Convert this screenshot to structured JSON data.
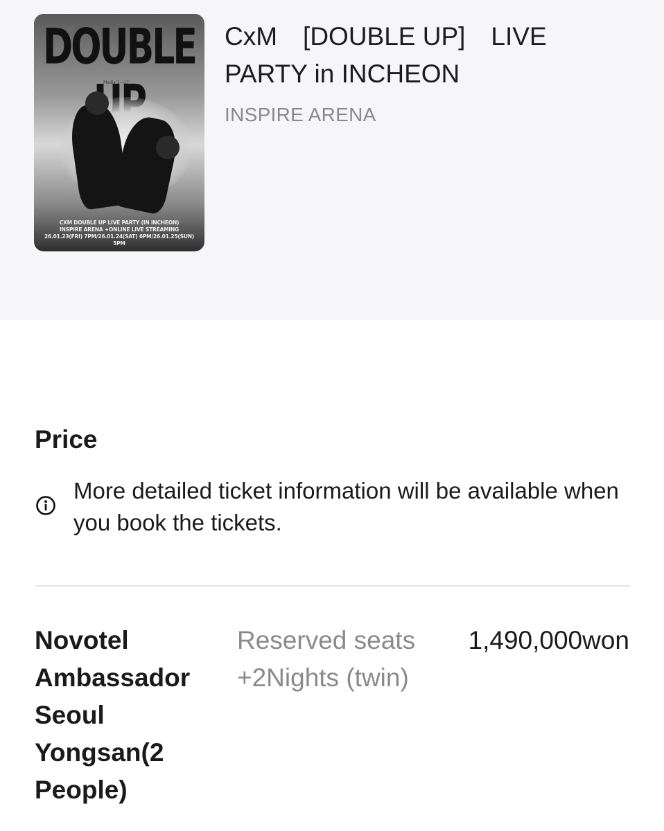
{
  "event": {
    "title": "CxM　[DOUBLE UP]　LIVE PARTY in INCHEON",
    "venue": "INSPIRE ARENA",
    "poster": {
      "headline": "DOUBLE UP",
      "small_text": "Pledis 1—17",
      "caption_line1": "CXM DOUBLE UP LIVE PARTY (IN INCHEON)",
      "caption_line2": "INSPIRE ARENA +ONLINE LIVE STREAMING",
      "caption_line3": "26.01.23(FRI) 7PM/26.01.24(SAT) 6PM/26.01.25(SUN) 5PM"
    }
  },
  "price_section": {
    "title": "Price",
    "info_icon": "info-circle-icon",
    "notice": "More detailed ticket information will be available when you book the tickets."
  },
  "price_rows": [
    {
      "name": "Novotel Ambassador Seoul Yongsan(2 People)",
      "description": "Reserved seats +2Nights (twin)",
      "price": "1,490,000won"
    }
  ],
  "colors": {
    "header_bg": "#f6f6f8",
    "secondary_text": "#8a8a8e",
    "divider": "#e6e6e8"
  }
}
